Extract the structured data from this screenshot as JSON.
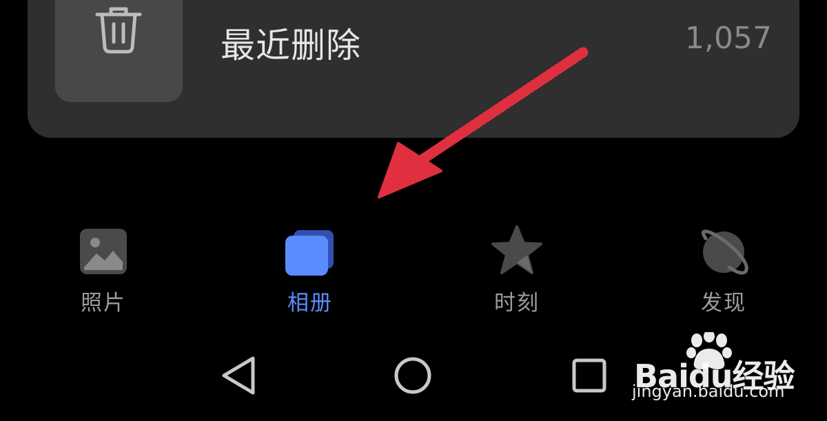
{
  "album": {
    "name": "最近删除",
    "count": "1,057"
  },
  "bottom_nav": {
    "items": [
      {
        "label": "照片",
        "icon": "photo-icon",
        "active": false
      },
      {
        "label": "相册",
        "icon": "albums-icon",
        "active": true
      },
      {
        "label": "时刻",
        "icon": "star-icon",
        "active": false
      },
      {
        "label": "发现",
        "icon": "planet-icon",
        "active": false
      }
    ]
  },
  "system_nav": {
    "back_icon": "back-triangle-icon",
    "home_icon": "home-circle-icon",
    "recents_icon": "recents-square-icon"
  },
  "watermark": {
    "logo": "Baidu经验",
    "url": "jingyan.baidu.com"
  },
  "colors": {
    "background": "#000000",
    "card": "#2f2f2f",
    "tile": "#484848",
    "accent": "#5b8cff",
    "inactive": "#9c9c9c",
    "annotation_arrow": "#e0303f"
  }
}
